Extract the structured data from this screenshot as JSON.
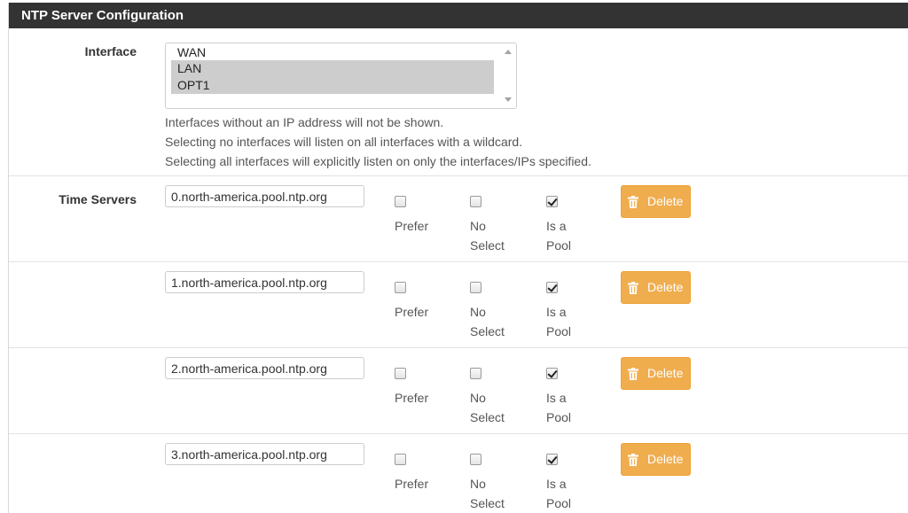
{
  "panel": {
    "title": "NTP Server Configuration"
  },
  "interface": {
    "label": "Interface",
    "options": [
      {
        "label": "WAN",
        "selected": false
      },
      {
        "label": "LAN",
        "selected": true
      },
      {
        "label": "OPT1",
        "selected": true
      }
    ],
    "help": [
      "Interfaces without an IP address will not be shown.",
      "Selecting no interfaces will listen on all interfaces with a wildcard.",
      "Selecting all interfaces will explicitly listen on only the interfaces/IPs specified."
    ]
  },
  "time_servers": {
    "label": "Time Servers",
    "prefer_label": "Prefer",
    "noselect_line1": "No",
    "noselect_line2": "Select",
    "pool_line1": "Is a",
    "pool_line2": "Pool",
    "delete_label": "Delete",
    "servers": [
      {
        "host": "0.north-america.pool.ntp.org",
        "prefer": false,
        "noselect": false,
        "ispool": true
      },
      {
        "host": "1.north-america.pool.ntp.org",
        "prefer": false,
        "noselect": false,
        "ispool": true
      },
      {
        "host": "2.north-america.pool.ntp.org",
        "prefer": false,
        "noselect": false,
        "ispool": true
      },
      {
        "host": "3.north-america.pool.ntp.org",
        "prefer": false,
        "noselect": false,
        "ispool": true
      }
    ]
  },
  "colors": {
    "header_bg": "#333333",
    "delete_bg": "#f0ad4e",
    "selected_option_bg": "#cdcdcd"
  },
  "icons": {
    "delete": "trash-icon",
    "scroll_up": "chevron-up-icon",
    "scroll_down": "chevron-down-icon"
  }
}
